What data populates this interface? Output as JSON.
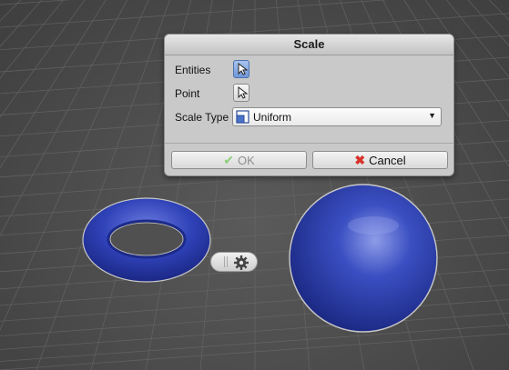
{
  "dialog": {
    "title": "Scale",
    "fields": {
      "entities_label": "Entities",
      "point_label": "Point",
      "scale_type_label": "Scale Type",
      "scale_type_value": "Uniform"
    },
    "buttons": {
      "ok_label": "OK",
      "cancel_label": "Cancel"
    }
  },
  "colors": {
    "object_blue": "#2c3fa0",
    "ok_check": "#8ccf7a",
    "cancel_x": "#d8322b"
  },
  "icons": {
    "entities": "cursor-arrow-icon",
    "point": "cursor-arrow-icon",
    "scale_type": "uniform-scale-icon",
    "ok": "check-icon",
    "cancel": "x-icon",
    "toolbar": "gear-icon"
  }
}
